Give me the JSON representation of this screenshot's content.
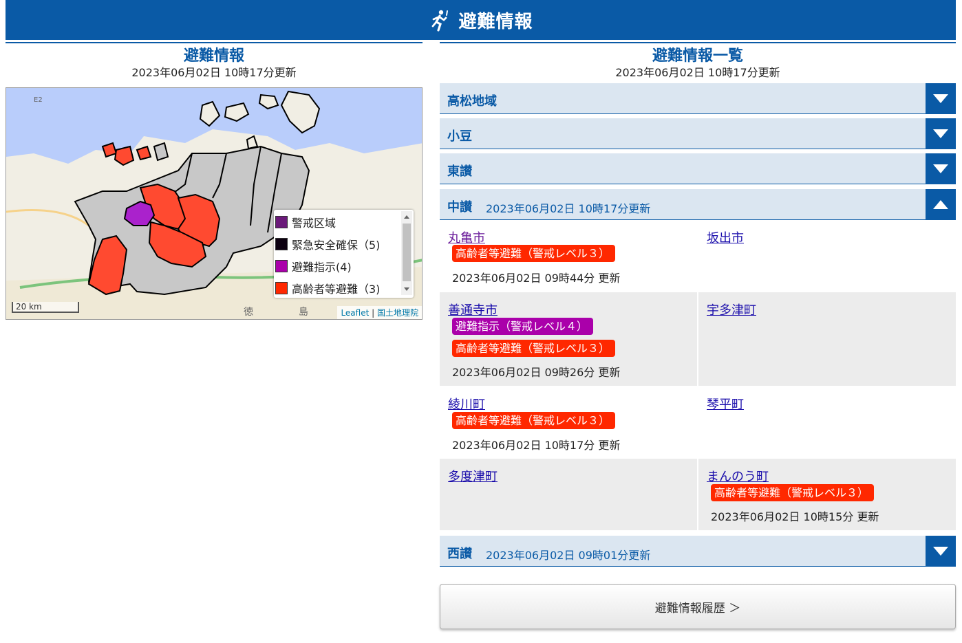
{
  "header": {
    "title": "避難情報",
    "icon": "running-person-icon"
  },
  "left": {
    "title": "避難情報",
    "updated": "2023年06月02日 10時17分更新",
    "map": {
      "legend": [
        {
          "label": "警戒区域",
          "color": "#6b1a7a"
        },
        {
          "label": "緊急安全確保（5)",
          "color": "#0c0010"
        },
        {
          "label": "避難指示(4)",
          "color": "#aa00aa"
        },
        {
          "label": "高齢者等避難（3)",
          "color": "#ff2800"
        }
      ],
      "scale": "20 km",
      "attribution_leaflet": "Leaflet",
      "attribution_sep": " | ",
      "attribution_gsi": "国土地理院"
    }
  },
  "right": {
    "title": "避難情報一覧",
    "updated": "2023年06月02日 10時17分更新",
    "regions": [
      {
        "name": "高松地域",
        "updated": ""
      },
      {
        "name": "小豆",
        "updated": ""
      },
      {
        "name": "東讃",
        "updated": ""
      },
      {
        "name": "中讃",
        "updated": "2023年06月02日 10時17分更新"
      },
      {
        "name": "西讃",
        "updated": "2023年06月02日 09時01分更新"
      }
    ],
    "cities": {
      "marugame": {
        "name": "丸亀市",
        "badges": [
          "高齢者等避難（警戒レベル３）"
        ],
        "date": "2023年06月02日 09時44分 更新"
      },
      "sakaide": {
        "name": "坂出市"
      },
      "zentsuji": {
        "name": "善通寺市",
        "badges": [
          "避難指示（警戒レベル４）",
          "高齢者等避難（警戒レベル３）"
        ],
        "date": "2023年06月02日 09時26分 更新"
      },
      "utazu": {
        "name": "宇多津町"
      },
      "ayagawa": {
        "name": "綾川町",
        "badges": [
          "高齢者等避難（警戒レベル３）"
        ],
        "date": "2023年06月02日 10時17分 更新"
      },
      "kotohira": {
        "name": "琴平町"
      },
      "tadotsu": {
        "name": "多度津町"
      },
      "manno": {
        "name": "まんのう町",
        "badges": [
          "高齢者等避難（警戒レベル３）"
        ],
        "date": "2023年06月02日 10時15分 更新"
      }
    },
    "history_button": "避難情報履歴 ＞"
  }
}
